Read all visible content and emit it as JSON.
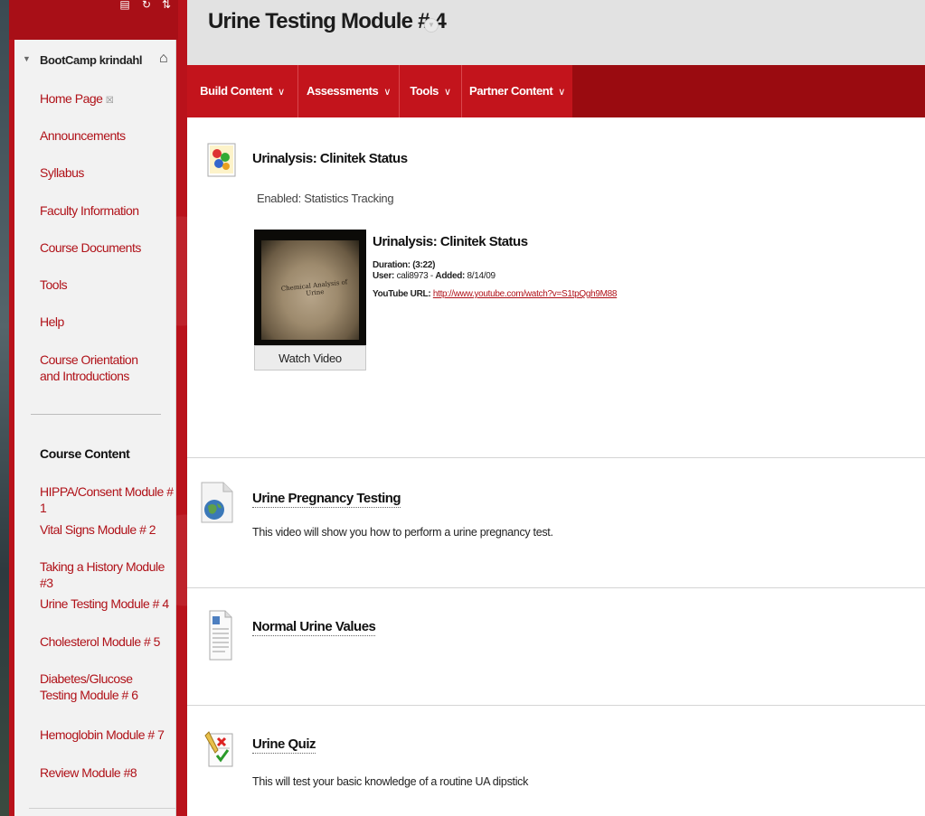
{
  "sidebar": {
    "course_name": "BootCamp krindahl",
    "menu": [
      {
        "label": "Home Page"
      },
      {
        "label": "Announcements"
      },
      {
        "label": "Syllabus"
      },
      {
        "label": "Faculty Information"
      },
      {
        "label": "Course Documents"
      },
      {
        "label": "Tools"
      },
      {
        "label": "Help"
      },
      {
        "label": "Course Orientation and Introductions"
      }
    ],
    "section_heading": "Course Content",
    "modules": [
      {
        "label": "HIPPA/Consent Module # 1"
      },
      {
        "label": "Vital Signs Module # 2"
      },
      {
        "label": "Taking a History Module #3"
      },
      {
        "label": "Urine Testing Module # 4"
      },
      {
        "label": "Cholesterol Module # 5"
      },
      {
        "label": "Diabetes/Glucose Testing Module # 6"
      },
      {
        "label": "Hemoglobin Module # 7"
      },
      {
        "label": "Review Module #8"
      }
    ]
  },
  "page": {
    "title": "Urine Testing Module # 4"
  },
  "action_bar": {
    "buttons": [
      {
        "label": "Build Content"
      },
      {
        "label": "Assessments"
      },
      {
        "label": "Tools"
      },
      {
        "label": "Partner Content"
      }
    ],
    "chevron": "∨"
  },
  "items": {
    "clinitek": {
      "title": "Urinalysis: Clinitek Status",
      "tracking_label": "Enabled:  Statistics Tracking",
      "video": {
        "title": "Urinalysis: Clinitek Status",
        "duration_label": "Duration:",
        "duration_value": "(3:22)",
        "user_label": "User:",
        "user_value": "cali8973",
        "added_label": "Added:",
        "added_value": "8/14/09",
        "youtube_label": "YouTube URL:",
        "youtube_url": "http://www.youtube.com/watch?v=S1tpQgh9M88",
        "thumb_caption": "Chemical Analysis of Urine",
        "watch_label": "Watch Video"
      }
    },
    "pregnancy": {
      "title": "Urine Pregnancy Testing",
      "description": "This video will show you how to perform a urine pregnancy test."
    },
    "normal_values": {
      "title": "Normal Urine Values"
    },
    "quiz": {
      "title": "Urine Quiz",
      "description": "This will test your basic knowledge of a routine UA dipstick"
    }
  }
}
